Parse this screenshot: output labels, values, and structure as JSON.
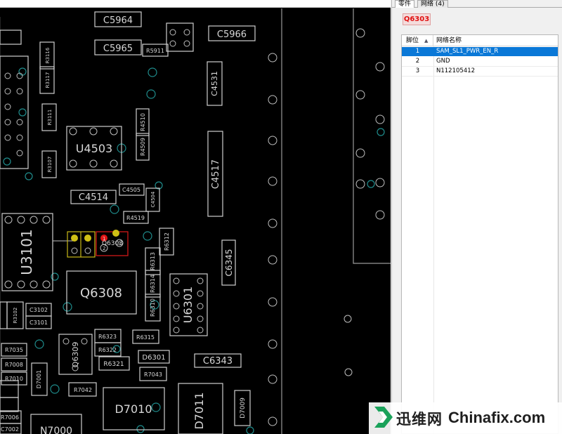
{
  "pcb": {
    "components": [
      {
        "id": "C5964",
        "label": "C5964"
      },
      {
        "id": "C5965",
        "label": "C5965"
      },
      {
        "id": "C5966",
        "label": "C5966"
      },
      {
        "id": "R5911",
        "label": "R5911"
      },
      {
        "id": "C4531",
        "label": "C4531"
      },
      {
        "id": "U4503",
        "label": "U4503"
      },
      {
        "id": "C4517",
        "label": "C4517"
      },
      {
        "id": "C4514",
        "label": "C4514"
      },
      {
        "id": "C4505",
        "label": "C4505"
      },
      {
        "id": "R4519",
        "label": "R4519"
      },
      {
        "id": "R4510",
        "label": "R4510"
      },
      {
        "id": "R4509",
        "label": "R4509"
      },
      {
        "id": "C4504",
        "label": "C4504"
      },
      {
        "id": "U3101",
        "label": "U3101"
      },
      {
        "id": "Q6303",
        "label": "Q6303"
      },
      {
        "id": "Q6308",
        "label": "Q6308"
      },
      {
        "id": "C6345",
        "label": "C6345"
      },
      {
        "id": "U6301",
        "label": "U6301"
      },
      {
        "id": "C6343",
        "label": "C6343"
      },
      {
        "id": "D6301",
        "label": "D6301"
      },
      {
        "id": "R6315",
        "label": "R6315"
      },
      {
        "id": "R6323",
        "label": "R6323"
      },
      {
        "id": "R6322",
        "label": "R6322"
      },
      {
        "id": "R6321",
        "label": "R6321"
      },
      {
        "id": "R6312",
        "label": "R6312"
      },
      {
        "id": "R6313",
        "label": "R6313"
      },
      {
        "id": "R6314",
        "label": "R6314"
      },
      {
        "id": "R6310",
        "label": "R6310"
      },
      {
        "id": "Q6309",
        "label": "Q6309"
      },
      {
        "id": "R7043",
        "label": "R7043"
      },
      {
        "id": "R7042",
        "label": "R7042"
      },
      {
        "id": "D7010",
        "label": "D7010"
      },
      {
        "id": "D7011",
        "label": "D7011"
      },
      {
        "id": "D7009",
        "label": "D7009"
      },
      {
        "id": "R3102",
        "label": "R3102"
      },
      {
        "id": "C3102",
        "label": "C3102"
      },
      {
        "id": "C3101",
        "label": "C3101"
      },
      {
        "id": "R7035",
        "label": "R7035"
      },
      {
        "id": "R7008",
        "label": "R7008"
      },
      {
        "id": "R7010",
        "label": "R7010"
      },
      {
        "id": "R7006",
        "label": "R7006"
      },
      {
        "id": "C7002",
        "label": "C7002"
      },
      {
        "id": "N7000",
        "label": "N7000"
      },
      {
        "id": "D7001",
        "label": "D7001"
      },
      {
        "id": "R3116",
        "label": "R3116"
      },
      {
        "id": "R3117",
        "label": "R3117"
      },
      {
        "id": "R3111",
        "label": "R3111"
      },
      {
        "id": "R3107",
        "label": "R3107"
      }
    ],
    "q6303_pins": [
      "1",
      "2",
      "3"
    ],
    "highlight_colors": {
      "selected_pin": "#e01414",
      "net_pin": "#cfc015",
      "selection_box": "#d01818",
      "connected_box": "#c8b818"
    }
  },
  "panel": {
    "tabs": [
      {
        "label": "零件",
        "active": true
      },
      {
        "label": "网络 (4)",
        "active": false
      }
    ],
    "part_name": "Q6303",
    "table": {
      "headers": {
        "pin": "脚位",
        "net": "网络名称"
      },
      "rows": [
        {
          "pin": "1",
          "net": "SAM_SL1_PWR_EN_R",
          "selected": true
        },
        {
          "pin": "2",
          "net": "GND",
          "selected": false
        },
        {
          "pin": "3",
          "net": "N112105412",
          "selected": false
        }
      ]
    }
  },
  "watermark": {
    "cn": "迅维网",
    "en": "Chinafix.com",
    "logo_color": "#1aa25a"
  }
}
